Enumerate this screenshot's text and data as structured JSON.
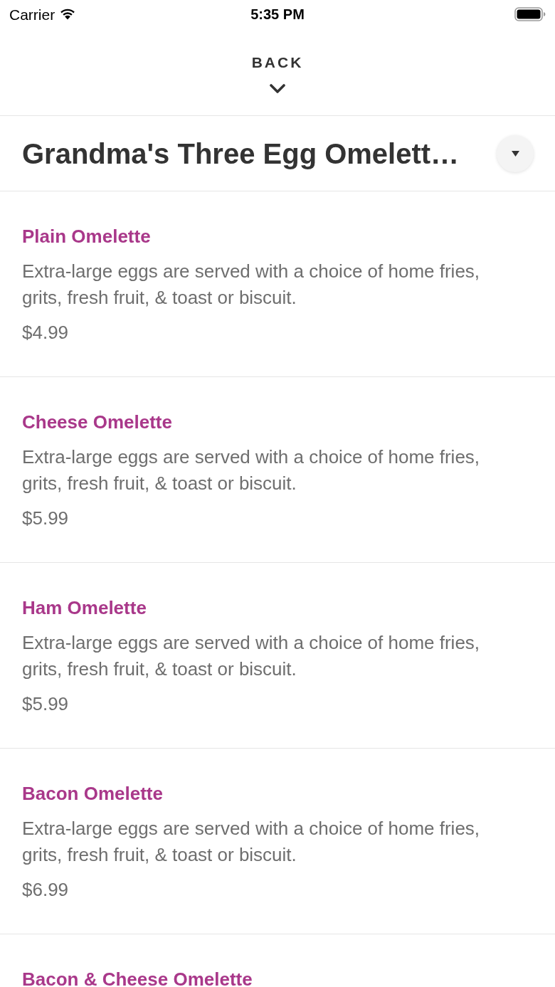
{
  "status_bar": {
    "carrier": "Carrier",
    "time": "5:35 PM"
  },
  "header": {
    "back_label": "BACK"
  },
  "category": {
    "title": "Grandma's Three Egg Omelett…"
  },
  "items": [
    {
      "name": "Plain Omelette",
      "description": "Extra-large eggs are served with a choice of home fries, grits, fresh fruit, & toast or biscuit.",
      "price": "$4.99"
    },
    {
      "name": "Cheese Omelette",
      "description": "Extra-large eggs are served with a choice of home fries, grits, fresh fruit, & toast or biscuit.",
      "price": "$5.99"
    },
    {
      "name": "Ham Omelette",
      "description": "Extra-large eggs are served with a choice of home fries, grits, fresh fruit, & toast or biscuit.",
      "price": "$5.99"
    },
    {
      "name": "Bacon Omelette",
      "description": "Extra-large eggs are served with a choice of home fries, grits, fresh fruit, & toast or biscuit.",
      "price": "$6.99"
    },
    {
      "name": "Bacon & Cheese Omelette"
    }
  ]
}
